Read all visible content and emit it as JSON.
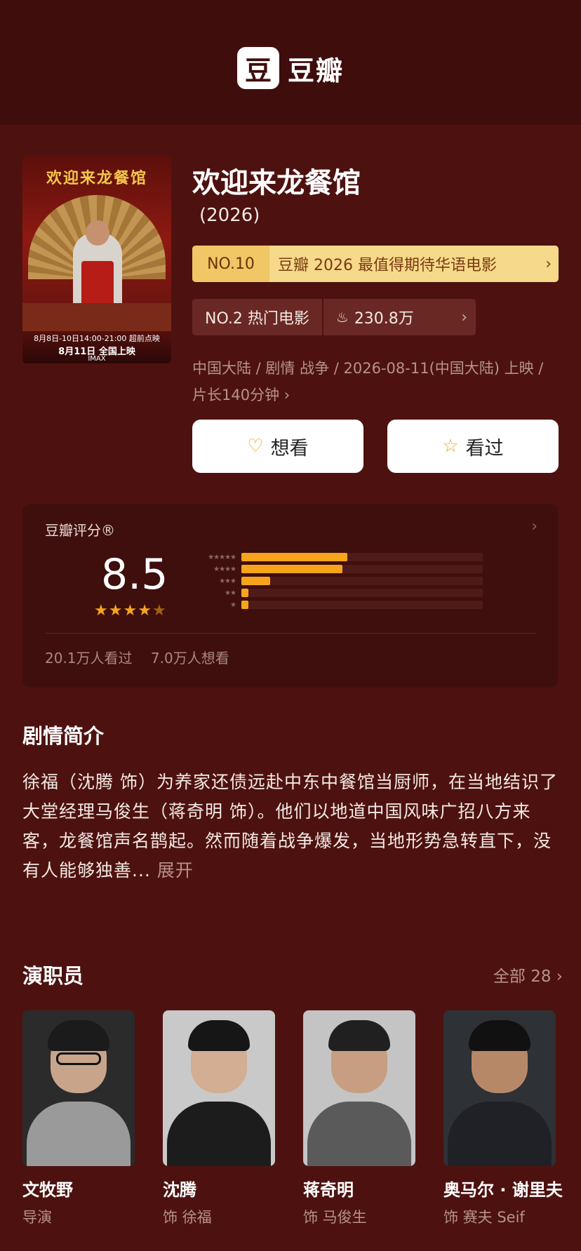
{
  "header": {
    "logo_char": "豆",
    "logo_text": "豆瓣"
  },
  "movie": {
    "title": "欢迎来龙餐馆",
    "year": "(2026)",
    "poster": {
      "title": "欢迎来龙餐馆",
      "line1": "8月8日-10日14:00-21:00 超前点映",
      "line2": "8月11日 全国上映",
      "line3": "IMAX"
    },
    "rank_banner": {
      "no": "NO.10",
      "text": "豆瓣 2026 最值得期待华语电影",
      "arrow": "›"
    },
    "hot": {
      "rank": "NO.2 热门电影",
      "count": "230.8万",
      "arrow": "›"
    },
    "meta": "中国大陆 / 剧情 战争 / 2026-08-11(中国大陆) 上映 / 片长140分钟 ›",
    "buttons": {
      "want": "想看",
      "seen": "看过"
    }
  },
  "rating": {
    "title": "豆瓣评分®",
    "arrow": "›",
    "score": "8.5",
    "stars_text": "★★★★★",
    "star_value": 4.5,
    "distribution": [
      {
        "stars": "★★★★★",
        "percent": 44
      },
      {
        "stars": "★★★★",
        "percent": 42
      },
      {
        "stars": "★★★",
        "percent": 12
      },
      {
        "stars": "★★",
        "percent": 3
      },
      {
        "stars": "★",
        "percent": 3
      }
    ],
    "seen_count": "20.1万人看过",
    "want_count": "7.0万人想看"
  },
  "synopsis": {
    "title": "剧情简介",
    "text": "徐福（沈腾 饰）为养家还债远赴中东中餐馆当厨师，在当地结识了大堂经理马俊生（蒋奇明 饰）。他们以地道中国风味广招八方来客，龙餐馆声名鹊起。然而随着战争爆发，当地形势急转直下，没有人能够独善...",
    "more": "展开"
  },
  "cast": {
    "title": "演职员",
    "all": "全部 28 ›",
    "members": [
      {
        "name": "文牧野",
        "role": "导演"
      },
      {
        "name": "沈腾",
        "role": "饰 徐福"
      },
      {
        "name": "蒋奇明",
        "role": "饰 马俊生"
      },
      {
        "name": "奥马尔 · 谢里夫",
        "role": "饰 赛夫 Seif"
      }
    ]
  },
  "colors": {
    "background": "#4d1210",
    "accent": "#f6a51b",
    "banner": "#f6d98a"
  }
}
